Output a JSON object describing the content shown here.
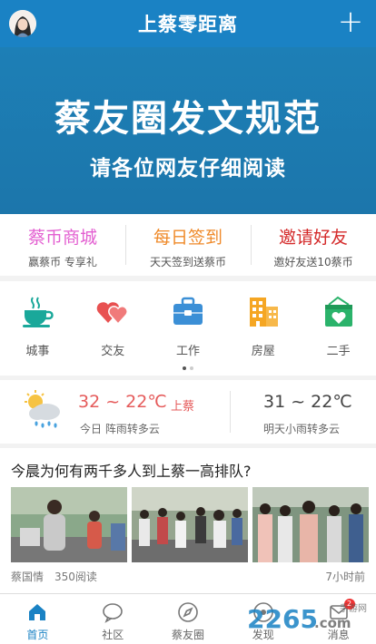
{
  "header": {
    "title": "上蔡零距离",
    "add_icon": "plus-icon"
  },
  "banner": {
    "line1": "蔡友圈发文规范",
    "line2": "请各位网友仔细阅读"
  },
  "promo": [
    {
      "title": "蔡币商城",
      "sub": "赢蔡币 专享礼",
      "color": "#e35fd1"
    },
    {
      "title": "每日签到",
      "sub": "天天签到送蔡币",
      "color": "#ef8a2a"
    },
    {
      "title": "邀请好友",
      "sub": "邀好友送10蔡币",
      "color": "#d42a2a"
    }
  ],
  "grid": [
    {
      "label": "城事",
      "icon": "coffee-cup-icon"
    },
    {
      "label": "交友",
      "icon": "hearts-icon"
    },
    {
      "label": "工作",
      "icon": "briefcase-icon"
    },
    {
      "label": "房屋",
      "icon": "buildings-icon"
    },
    {
      "label": "二手",
      "icon": "basket-heart-icon"
    }
  ],
  "weather": {
    "today_temp": "32 ~ 22℃",
    "city": "上蔡",
    "today_desc": "今日 阵雨转多云",
    "tomorrow_temp": "31 ~ 22℃",
    "tomorrow_desc": "明天小雨转多云"
  },
  "news": {
    "title": "今晨为何有两千多人到上蔡一高排队?",
    "author": "蔡国情",
    "reads": "350阅读",
    "time": "7小时前"
  },
  "tabs": [
    {
      "label": "首页",
      "icon": "home-icon",
      "active": true
    },
    {
      "label": "社区",
      "icon": "chat-bubble-icon"
    },
    {
      "label": "蔡友圈",
      "icon": "compass-icon"
    },
    {
      "label": "发现",
      "icon": "discover-icon"
    },
    {
      "label": "消息",
      "icon": "message-icon",
      "badge": "2"
    }
  ],
  "watermark": {
    "text": "2265.com",
    "sub": "手游网"
  },
  "colors": {
    "brand": "#1a82c4",
    "accent_red": "#e55b5b"
  }
}
